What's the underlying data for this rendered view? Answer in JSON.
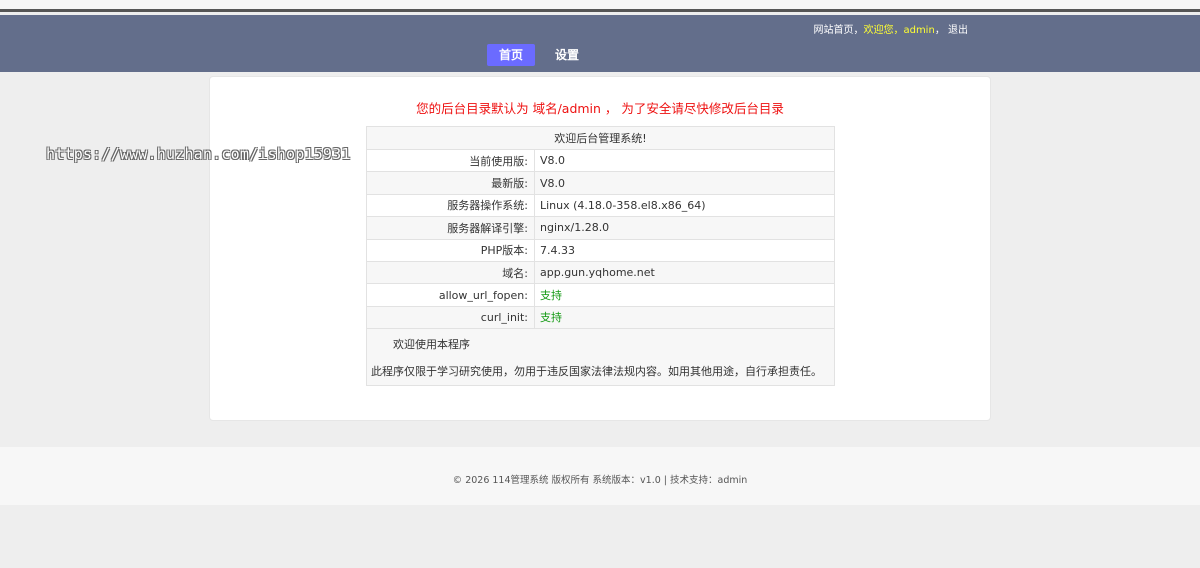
{
  "header": {
    "site_home": "网站首页",
    "welcome": "欢迎您，admin",
    "sep": "，",
    "logout": "退出"
  },
  "nav": [
    {
      "label": "首页",
      "active": true
    },
    {
      "label": "设置",
      "active": false
    }
  ],
  "notice": "您的后台目录默认为 域名/admin ， 为了安全请尽快修改后台目录",
  "table": {
    "title": "欢迎后台管理系统!",
    "rows": [
      {
        "label": "当前使用版:",
        "value": "V8.0"
      },
      {
        "label": "最新版:",
        "value": "V8.0"
      },
      {
        "label": "服务器操作系统:",
        "value": "Linux (4.18.0-358.el8.x86_64)"
      },
      {
        "label": "服务器解译引擎:",
        "value": "nginx/1.28.0"
      },
      {
        "label": "PHP版本:",
        "value": "7.4.33"
      },
      {
        "label": "域名:",
        "value": "app.gun.yqhome.net"
      },
      {
        "label": "allow_url_fopen:",
        "value": "支持"
      },
      {
        "label": "curl_init:",
        "value": "支持"
      }
    ],
    "about_title": "欢迎使用本程序",
    "about_text": "此程序仅限于学习研究使用，勿用于违反国家法律法规内容。如用其他用途，自行承担责任。"
  },
  "watermark": "https://www.huzhan.com/ishop15931",
  "footer": "© 2026 114管理系统 版权所有 系统版本：v1.0 | 技术支持：admin",
  "colors": {
    "header_bg": "#636e8b",
    "nav_active": "#6b6bff",
    "notice": "#ee1111",
    "support": "#119911"
  }
}
